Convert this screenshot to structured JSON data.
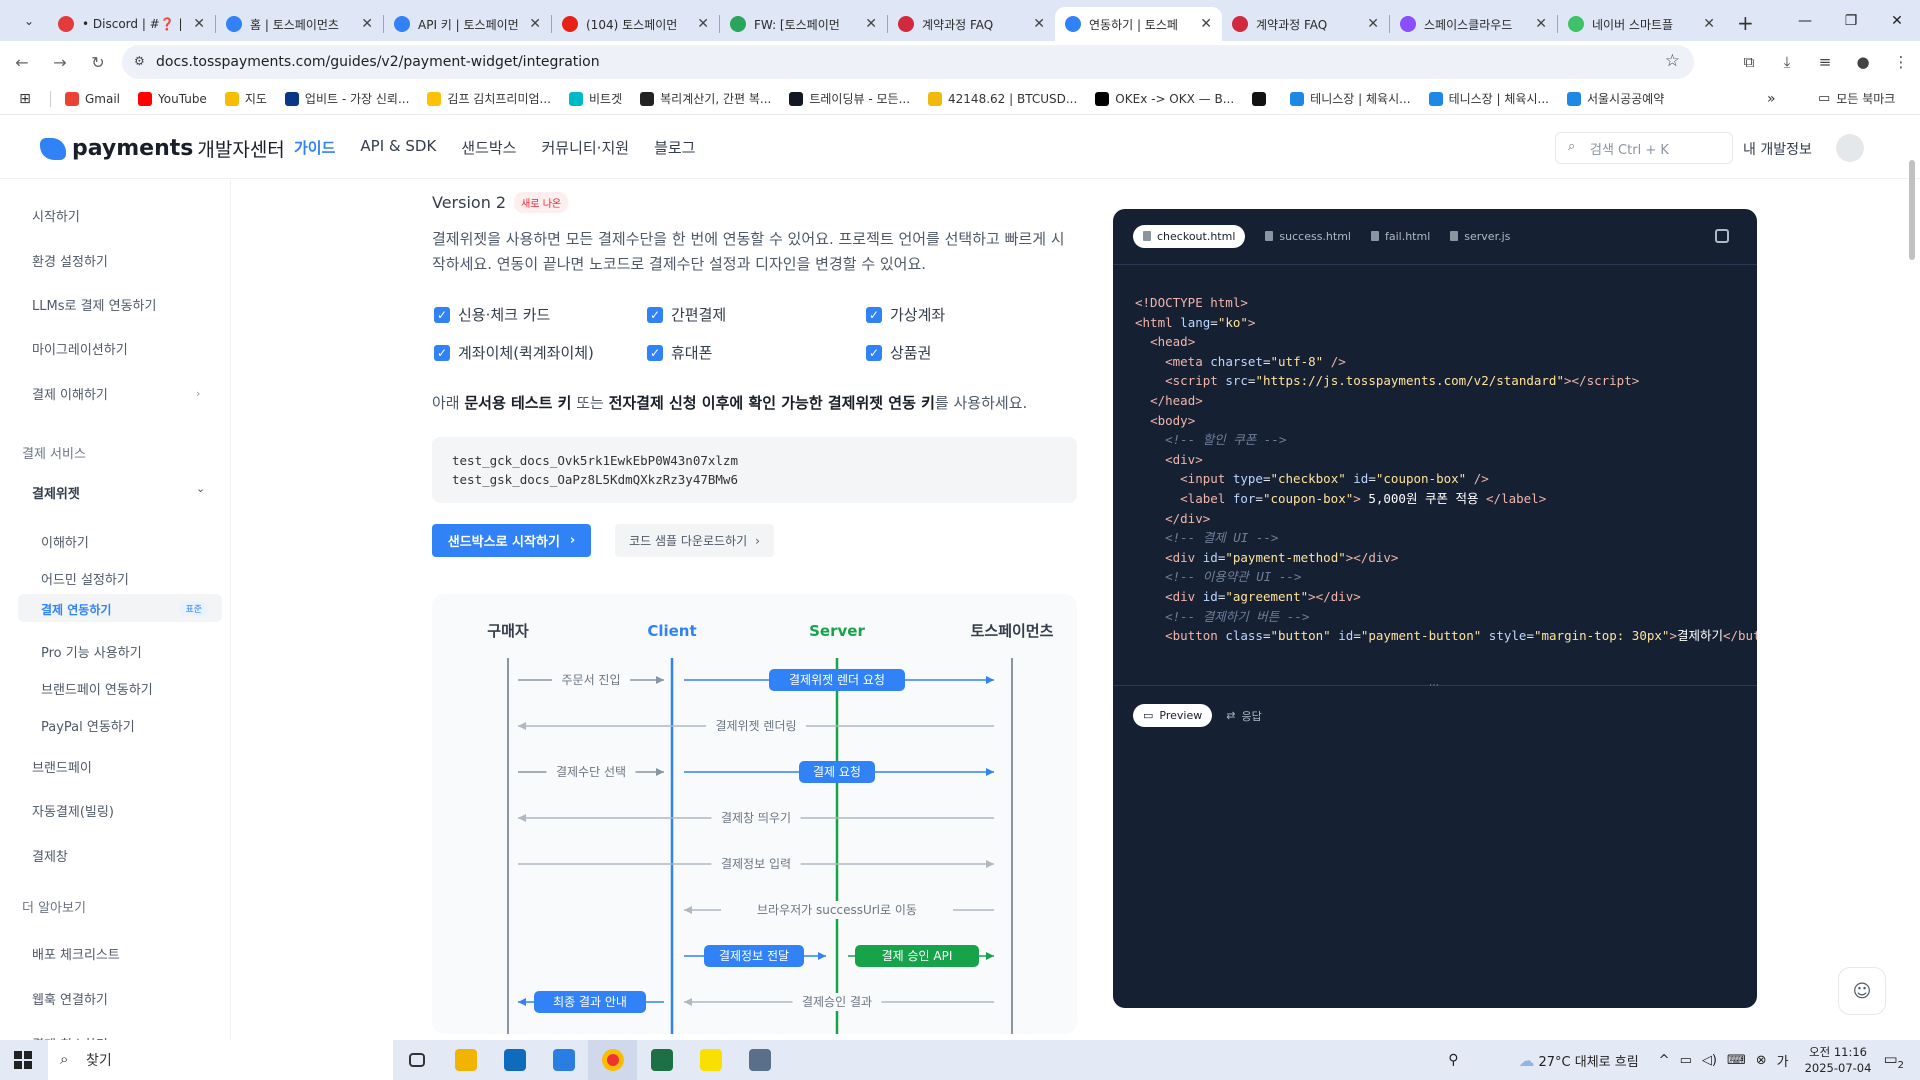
{
  "browser": {
    "tabs": [
      {
        "title": "• Discord | #❓ | ",
        "fav_color": "#e23b3b"
      },
      {
        "title": "홈 | 토스페이먼츠",
        "fav_color": "#3182f6"
      },
      {
        "title": "API 키 | 토스페이먼",
        "fav_color": "#3182f6"
      },
      {
        "title": "(104) 토스페이먼",
        "fav_color": "#e62117"
      },
      {
        "title": "FW: [토스페이먼",
        "fav_color": "#2aa55b"
      },
      {
        "title": "계약과정 FAQ",
        "fav_color": "#d1293d"
      },
      {
        "title": "연동하기 | 토스페",
        "fav_color": "#3182f6",
        "active": true
      },
      {
        "title": "계약과정 FAQ",
        "fav_color": "#d1293d"
      },
      {
        "title": "스페이스클라우드",
        "fav_color": "#8a4dff"
      },
      {
        "title": "네이버 스마트플",
        "fav_color": "#3fc165"
      }
    ],
    "url": "docs.tosspayments.com/guides/v2/payment-widget/integration",
    "bookmarks": [
      {
        "label": "Gmail",
        "color": "#ea4335"
      },
      {
        "label": "YouTube",
        "color": "#ff0000"
      },
      {
        "label": "지도",
        "color": "#fbbc04"
      },
      {
        "label": "업비트 - 가장 신뢰...",
        "color": "#093687"
      },
      {
        "label": "김프 김치프리미엄...",
        "color": "#ffc107"
      },
      {
        "label": "비트겟",
        "color": "#00b9c6"
      },
      {
        "label": "복리계산기, 간편 복...",
        "color": "#222222"
      },
      {
        "label": "트레이딩뷰 - 모든...",
        "color": "#131722"
      },
      {
        "label": "42148.62 | BTCUSD...",
        "color": "#f0b90b"
      },
      {
        "label": "OKEx -> OKX — B...",
        "color": "#000000"
      },
      {
        "label": "",
        "color": "#111111"
      },
      {
        "label": "테니스장 | 체육시...",
        "color": "#1e88e5"
      },
      {
        "label": "테니스장 | 체육시...",
        "color": "#1e88e5"
      },
      {
        "label": "서울시공공예약",
        "color": "#1e88e5"
      }
    ],
    "all_bookmarks": "모든 북마크"
  },
  "header": {
    "logo_text": "payments",
    "logo_sub": "개발자센터",
    "nav": [
      "가이드",
      "API & SDK",
      "샌드박스",
      "커뮤니티·지원",
      "블로그"
    ],
    "search_placeholder": "검색 Ctrl + K",
    "my_dev": "내 개발정보"
  },
  "sidebar": {
    "top_items": [
      "시작하기",
      "환경 설정하기",
      "LLMs로 결제 연동하기",
      "마이그레이션하기",
      "결제 이해하기"
    ],
    "group1": "결제 서비스",
    "widget": "결제위젯",
    "widget_sub": [
      "이해하기",
      "어드민 설정하기",
      "결제 연동하기",
      "Pro 기능 사용하기",
      "브랜드페이 연동하기",
      "PayPal 연동하기"
    ],
    "active_badge": "표준",
    "mid_items": [
      "브랜드페이",
      "자동결제(빌링)",
      "결제창"
    ],
    "group2": "더 알아보기",
    "bottom_items": [
      "배포 체크리스트",
      "웹훅 연결하기",
      "결제 취소하기"
    ]
  },
  "main": {
    "version": "Version 2",
    "new_badge": "새로 나온",
    "desc": "결제위젯을 사용하면 모든 결제수단을 한 번에 연동할 수 있어요. 프로젝트 언어를 선택하고 빠르게 시작하세요. 연동이 끝나면 노코드로 결제수단 설정과 디자인을 변경할 수 있어요.",
    "methods": [
      "신용·체크 카드",
      "간편결제",
      "가상계좌",
      "계좌이체(퀵계좌이체)",
      "휴대폰",
      "상품권"
    ],
    "note_pre": "아래 ",
    "note_b1": "문서용 테스트 키",
    "note_mid": " 또는 ",
    "note_b2": "전자결제 신청 이후에 확인 가능한 결제위젯 연동 키",
    "note_post": "를 사용하세요.",
    "key1": "test_gck_docs_Ovk5rk1EwkEbP0W43n07xlzm",
    "key2": "test_gsk_docs_OaPz8L5KdmQXkzRz3y47BMw6",
    "btn_sandbox": "샌드박스로 시작하기",
    "btn_download": "코드 샘플 다운로드하기"
  },
  "diagram": {
    "actors": [
      "구매자",
      "Client",
      "Server",
      "토스페이먼츠"
    ],
    "steps": [
      "주문서 진입",
      "결제위젯 렌더 요청",
      "결제위젯 렌더링",
      "결제수단 선택",
      "결제 요청",
      "결제창 띄우기",
      "결제정보 입력",
      "브라우저가 successUrl로 이동",
      "결제정보 전달",
      "결제 승인 API",
      "최종 결과 안내",
      "결제승인 결과"
    ]
  },
  "code_panel": {
    "tabs": [
      "checkout.html",
      "success.html",
      "fail.html",
      "server.js"
    ],
    "preview_tabs": [
      "Preview",
      "응답"
    ]
  },
  "taskbar": {
    "search": "찾기",
    "weather": "27°C  대체로 흐림",
    "time": "오전 11:16",
    "date": "2025-07-04",
    "notif": "2"
  }
}
